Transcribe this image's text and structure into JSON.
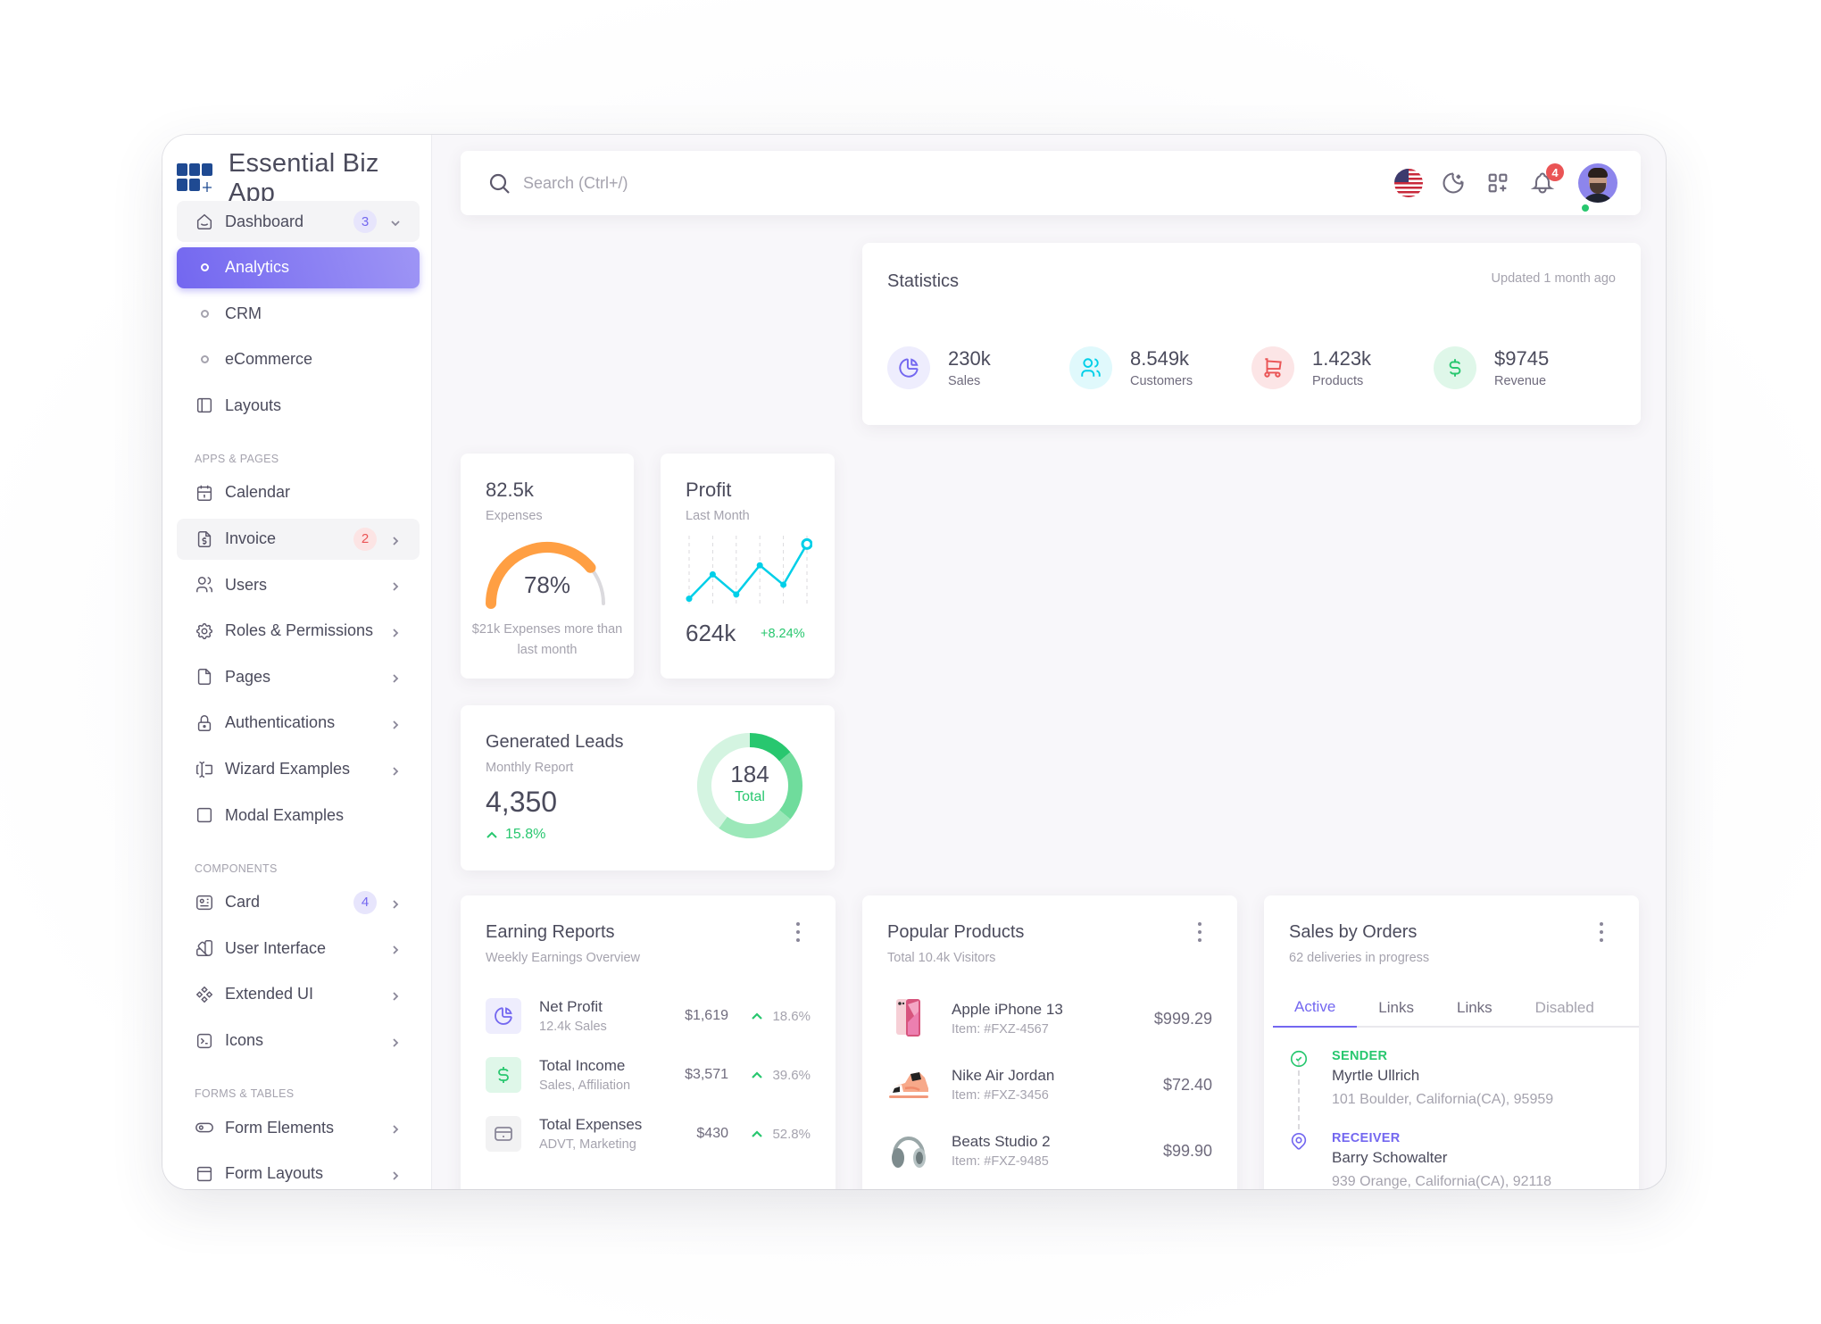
{
  "app": {
    "title": "Essential Biz App"
  },
  "sidebar": {
    "items": [
      {
        "label": "Dashboard",
        "icon": "home-icon",
        "badge": "3",
        "chevron": "down"
      },
      {
        "label": "Analytics",
        "icon": "circle-icon",
        "active": true
      },
      {
        "label": "CRM",
        "icon": "circle-icon"
      },
      {
        "label": "eCommerce",
        "icon": "circle-icon"
      },
      {
        "label": "Layouts",
        "icon": "layout-sidebar-icon"
      }
    ],
    "sections": [
      {
        "header": "APPS & PAGES",
        "items": [
          {
            "label": "Calendar",
            "icon": "calendar-icon"
          },
          {
            "label": "Invoice",
            "icon": "file-dollar-icon",
            "badge": "2"
          },
          {
            "label": "Users",
            "icon": "users-icon"
          },
          {
            "label": "Roles & Permissions",
            "icon": "settings-icon"
          },
          {
            "label": "Pages",
            "icon": "file-icon"
          },
          {
            "label": "Authentications",
            "icon": "lock-icon"
          },
          {
            "label": "Wizard Examples",
            "icon": "forms-icon"
          },
          {
            "label": "Modal Examples",
            "icon": "square-icon"
          }
        ]
      },
      {
        "header": "COMPONENTS",
        "items": [
          {
            "label": "Card",
            "icon": "id-card-icon",
            "badge": "4"
          },
          {
            "label": "User Interface",
            "icon": "color-swatch-icon"
          },
          {
            "label": "Extended UI",
            "icon": "components-icon"
          },
          {
            "label": "Icons",
            "icon": "terminal-icon"
          }
        ]
      },
      {
        "header": "FORMS & TABLES",
        "items": [
          {
            "label": "Form Elements",
            "icon": "toggle-icon"
          },
          {
            "label": "Form Layouts",
            "icon": "layout-navbar-icon"
          }
        ]
      }
    ]
  },
  "topbar": {
    "search_placeholder": "Search (Ctrl+/)",
    "search_value": "",
    "notifications_count": "4",
    "icons": [
      "us-flag-icon",
      "moon-stars-icon",
      "apps-add-icon",
      "bell-icon",
      "avatar"
    ]
  },
  "statistics": {
    "title": "Statistics",
    "updated": "Updated 1 month ago",
    "items": [
      {
        "value": "230k",
        "label": "Sales",
        "icon": "chart-pie-icon",
        "color": "#7367f0",
        "bg": "#eeedfd"
      },
      {
        "value": "8.549k",
        "label": "Customers",
        "icon": "users-icon",
        "color": "#00cfe8",
        "bg": "#e0f9fc"
      },
      {
        "value": "1.423k",
        "label": "Products",
        "icon": "shopping-cart-icon",
        "color": "#ea5455",
        "bg": "#fce5e6"
      },
      {
        "value": "$9745",
        "label": "Revenue",
        "icon": "currency-dollar-icon",
        "color": "#28c76f",
        "bg": "#dff7e9"
      }
    ]
  },
  "expenses": {
    "value": "82.5k",
    "label": "Expenses",
    "percent": 78,
    "percent_label": "78%",
    "note": "$21k Expenses more than last month",
    "color": "#ff9f43"
  },
  "profit": {
    "title": "Profit",
    "subtitle": "Last Month",
    "value": "624k",
    "change": "+8.24%",
    "sparkline": [
      5,
      45,
      12,
      60,
      28,
      95
    ],
    "color": "#00cfe8"
  },
  "leads": {
    "title": "Generated Leads",
    "subtitle": "Monthly Report",
    "value": "4,350",
    "change": "15.8%",
    "donut_total": "184",
    "donut_label": "Total",
    "donut_segments": [
      {
        "value": 14,
        "color": "#28c76f"
      },
      {
        "value": 22,
        "color": "#6fdc9c"
      },
      {
        "value": 24,
        "color": "#9be8b9"
      },
      {
        "value": 40,
        "color": "#d4f4e1"
      }
    ]
  },
  "earning": {
    "title": "Earning Reports",
    "subtitle": "Weekly Earnings Overview",
    "rows": [
      {
        "name": "Net Profit",
        "desc": "12.4k Sales",
        "amount": "$1,619",
        "pct": "18.6%",
        "icon": "chart-pie-icon",
        "color": "#7367f0",
        "bg": "#eeedfd"
      },
      {
        "name": "Total Income",
        "desc": "Sales, Affiliation",
        "amount": "$3,571",
        "pct": "39.6%",
        "icon": "currency-dollar-icon",
        "color": "#28c76f",
        "bg": "#dff7e9"
      },
      {
        "name": "Total Expenses",
        "desc": "ADVT, Marketing",
        "amount": "$430",
        "pct": "52.8%",
        "icon": "credit-card-icon",
        "color": "#8a8799",
        "bg": "#f2f2f3"
      }
    ]
  },
  "popular": {
    "title": "Popular Products",
    "subtitle": "Total 10.4k Visitors",
    "rows": [
      {
        "name": "Apple iPhone 13",
        "item": "Item: #FXZ-4567",
        "price": "$999.29",
        "image": "iphone-image"
      },
      {
        "name": "Nike Air Jordan",
        "item": "Item: #FXZ-3456",
        "price": "$72.40",
        "image": "sneaker-image"
      },
      {
        "name": "Beats Studio 2",
        "item": "Item: #FXZ-9485",
        "price": "$99.90",
        "image": "headphones-image"
      }
    ]
  },
  "sales": {
    "title": "Sales by Orders",
    "subtitle": "62 deliveries in progress",
    "tabs": [
      {
        "label": "Active",
        "state": "active"
      },
      {
        "label": "Links",
        "state": "normal"
      },
      {
        "label": "Links",
        "state": "normal"
      },
      {
        "label": "Disabled",
        "state": "disabled"
      }
    ],
    "timeline": [
      {
        "role": "SENDER",
        "name": "Myrtle Ullrich",
        "address": "101 Boulder, California(CA), 95959",
        "color": "#28c76f",
        "icon": "circle-check-icon"
      },
      {
        "role": "RECEIVER",
        "name": "Barry Schowalter",
        "address": "939 Orange, California(CA), 92118",
        "color": "#7367f0",
        "icon": "map-pin-icon"
      }
    ]
  }
}
